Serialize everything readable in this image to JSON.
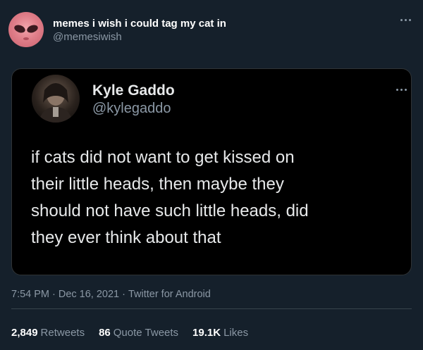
{
  "tweet": {
    "author": {
      "name": "memes i wish i could tag my cat in",
      "handle": "@memesiwish",
      "avatar_icon": "alien-face-icon",
      "avatar_color": "#e07f8a"
    },
    "embedded": {
      "author_name": "Kyle Gaddo",
      "author_handle": "@kylegaddo",
      "text_lines": [
        "if cats did not want to get kissed on",
        "their little heads, then maybe they",
        "should not have such little heads, did",
        "they ever think about that"
      ]
    },
    "meta": {
      "time": "7:54 PM",
      "date": "Dec 16, 2021",
      "separator": "·",
      "source": "Twitter for Android"
    },
    "stats": {
      "retweets_count": "2,849",
      "retweets_label": "Retweets",
      "quotes_count": "86",
      "quotes_label": "Quote Tweets",
      "likes_count": "19.1K",
      "likes_label": "Likes"
    },
    "colors": {
      "background": "#15202b",
      "embed_background": "#000000",
      "secondary_text": "#8b98a5",
      "divider": "#38444d"
    }
  }
}
